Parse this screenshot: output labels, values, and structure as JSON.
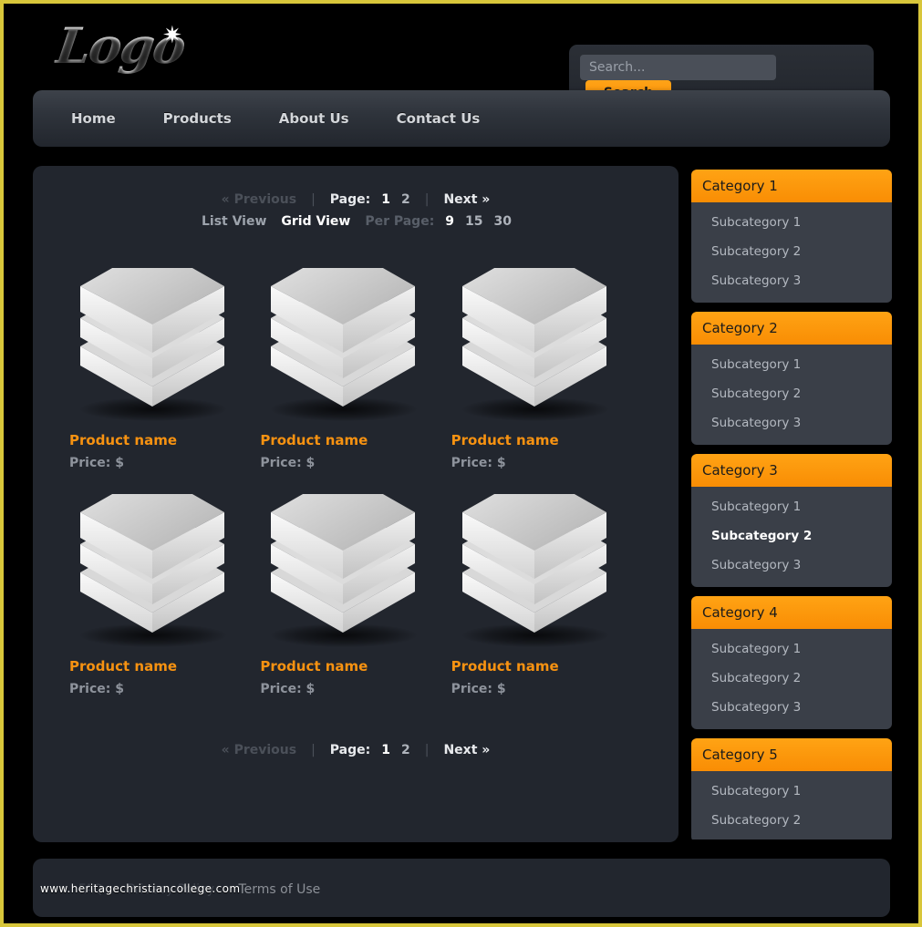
{
  "theme": {
    "accent": "#F98D04",
    "page_border": "#D8C63A",
    "panel_bg": "#22262E",
    "subcat_bg": "#3A3F48"
  },
  "header": {
    "logo_text": "Logo",
    "logo_star": "✷",
    "search": {
      "placeholder": "Search...",
      "value": "",
      "button_label": "Search"
    }
  },
  "nav": {
    "items": [
      {
        "label": "Home"
      },
      {
        "label": "Products"
      },
      {
        "label": "About Us"
      },
      {
        "label": "Contact Us"
      }
    ]
  },
  "toolbar_top": {
    "previous_label": "« Previous",
    "page_label": "Page:",
    "pages": [
      "1",
      "2"
    ],
    "active_page": "1",
    "next_label": "Next »",
    "list_view_label": "List View",
    "grid_view_label": "Grid View",
    "active_view": "Grid View",
    "per_page_label": "Per Page:",
    "per_page_options": [
      "9",
      "15",
      "30"
    ],
    "active_per_page": "9"
  },
  "toolbar_bottom": {
    "previous_label": "« Previous",
    "page_label": "Page:",
    "pages": [
      "1",
      "2"
    ],
    "active_page": "1",
    "next_label": "Next »"
  },
  "products": [
    {
      "name": "Product name",
      "price": "Price: $"
    },
    {
      "name": "Product name",
      "price": "Price: $"
    },
    {
      "name": "Product name",
      "price": "Price: $"
    },
    {
      "name": "Product name",
      "price": "Price: $"
    },
    {
      "name": "Product name",
      "price": "Price: $"
    },
    {
      "name": "Product name",
      "price": "Price: $"
    }
  ],
  "sidebar": {
    "categories": [
      {
        "title": "Category 1",
        "subcategories": [
          {
            "label": "Subcategory 1",
            "active": false
          },
          {
            "label": "Subcategory 2",
            "active": false
          },
          {
            "label": "Subcategory 3",
            "active": false
          }
        ]
      },
      {
        "title": "Category 2",
        "subcategories": [
          {
            "label": "Subcategory 1",
            "active": false
          },
          {
            "label": "Subcategory 2",
            "active": false
          },
          {
            "label": "Subcategory 3",
            "active": false
          }
        ]
      },
      {
        "title": "Category 3",
        "subcategories": [
          {
            "label": "Subcategory 1",
            "active": false
          },
          {
            "label": "Subcategory 2",
            "active": true
          },
          {
            "label": "Subcategory 3",
            "active": false
          }
        ]
      },
      {
        "title": "Category 4",
        "subcategories": [
          {
            "label": "Subcategory 1",
            "active": false
          },
          {
            "label": "Subcategory 2",
            "active": false
          },
          {
            "label": "Subcategory 3",
            "active": false
          }
        ]
      },
      {
        "title": "Category 5",
        "subcategories": [
          {
            "label": "Subcategory 1",
            "active": false
          },
          {
            "label": "Subcategory 2",
            "active": false
          }
        ]
      }
    ]
  },
  "footer": {
    "links": [
      {
        "label": "FAQ",
        "lighter": false
      },
      {
        "label": "Privacy Policy",
        "lighter": false
      },
      {
        "label": "Terms of Use",
        "lighter": true
      }
    ]
  },
  "watermark": {
    "text": "www.heritagechristiancollege.com"
  }
}
